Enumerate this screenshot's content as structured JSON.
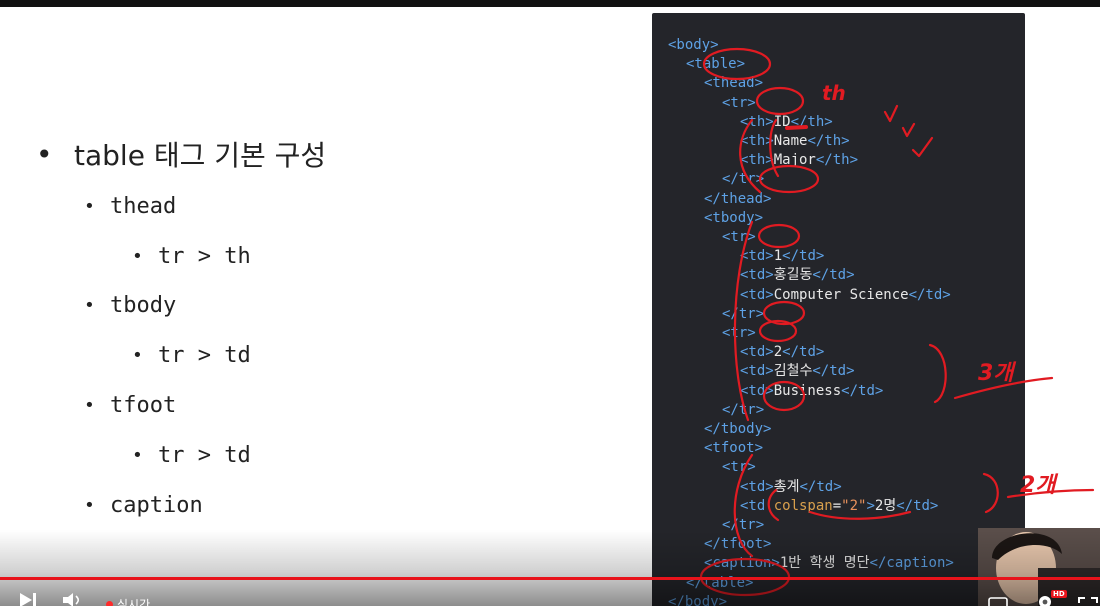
{
  "slide": {
    "bullets": [
      {
        "level": 1,
        "text": "table 태그 기본 구성"
      },
      {
        "level": 2,
        "text": "thead"
      },
      {
        "level": 3,
        "text": "tr > th"
      },
      {
        "level": 2,
        "text": "tbody"
      },
      {
        "level": 3,
        "text": "tr > td"
      },
      {
        "level": 2,
        "text": "tfoot"
      },
      {
        "level": 3,
        "text": "tr > td"
      },
      {
        "level": 2,
        "text": "caption"
      }
    ],
    "bullet_glyphs": {
      "level1": "•",
      "level2": "•",
      "level3": "•"
    }
  },
  "code": {
    "lines": [
      {
        "indent": 0,
        "parts": [
          {
            "t": "tag",
            "v": "<body>"
          }
        ]
      },
      {
        "indent": 1,
        "parts": [
          {
            "t": "tag",
            "v": "<table>"
          }
        ]
      },
      {
        "indent": 2,
        "parts": [
          {
            "t": "tag",
            "v": "<thead>"
          }
        ]
      },
      {
        "indent": 3,
        "parts": [
          {
            "t": "tag",
            "v": "<tr>"
          }
        ]
      },
      {
        "indent": 4,
        "parts": [
          {
            "t": "tag",
            "v": "<th>"
          },
          {
            "t": "txt",
            "v": "ID"
          },
          {
            "t": "tag",
            "v": "</th>"
          }
        ]
      },
      {
        "indent": 4,
        "parts": [
          {
            "t": "tag",
            "v": "<th>"
          },
          {
            "t": "txt",
            "v": "Name"
          },
          {
            "t": "tag",
            "v": "</th>"
          }
        ]
      },
      {
        "indent": 4,
        "parts": [
          {
            "t": "tag",
            "v": "<th>"
          },
          {
            "t": "txt",
            "v": "Major"
          },
          {
            "t": "tag",
            "v": "</th>"
          }
        ]
      },
      {
        "indent": 3,
        "parts": [
          {
            "t": "tag",
            "v": "</tr>"
          }
        ]
      },
      {
        "indent": 2,
        "parts": [
          {
            "t": "tag",
            "v": "</thead>"
          }
        ]
      },
      {
        "indent": 2,
        "parts": [
          {
            "t": "tag",
            "v": "<tbody>"
          }
        ]
      },
      {
        "indent": 3,
        "parts": [
          {
            "t": "tag",
            "v": "<tr>"
          }
        ]
      },
      {
        "indent": 4,
        "parts": [
          {
            "t": "tag",
            "v": "<td>"
          },
          {
            "t": "txt",
            "v": "1"
          },
          {
            "t": "tag",
            "v": "</td>"
          }
        ]
      },
      {
        "indent": 4,
        "parts": [
          {
            "t": "tag",
            "v": "<td>"
          },
          {
            "t": "txt",
            "v": "홍길동"
          },
          {
            "t": "tag",
            "v": "</td>"
          }
        ]
      },
      {
        "indent": 4,
        "parts": [
          {
            "t": "tag",
            "v": "<td>"
          },
          {
            "t": "txt",
            "v": "Computer Science"
          },
          {
            "t": "tag",
            "v": "</td>"
          }
        ]
      },
      {
        "indent": 3,
        "parts": [
          {
            "t": "tag",
            "v": "</tr>"
          }
        ]
      },
      {
        "indent": 3,
        "parts": [
          {
            "t": "tag",
            "v": "<tr>"
          }
        ]
      },
      {
        "indent": 4,
        "parts": [
          {
            "t": "tag",
            "v": "<td>"
          },
          {
            "t": "txt",
            "v": "2"
          },
          {
            "t": "tag",
            "v": "</td>"
          }
        ]
      },
      {
        "indent": 4,
        "parts": [
          {
            "t": "tag",
            "v": "<td>"
          },
          {
            "t": "txt",
            "v": "김철수"
          },
          {
            "t": "tag",
            "v": "</td>"
          }
        ]
      },
      {
        "indent": 4,
        "parts": [
          {
            "t": "tag",
            "v": "<td>"
          },
          {
            "t": "txt",
            "v": "Business"
          },
          {
            "t": "tag",
            "v": "</td>"
          }
        ]
      },
      {
        "indent": 3,
        "parts": [
          {
            "t": "tag",
            "v": "</tr>"
          }
        ]
      },
      {
        "indent": 2,
        "parts": [
          {
            "t": "tag",
            "v": "</tbody>"
          }
        ]
      },
      {
        "indent": 2,
        "parts": [
          {
            "t": "tag",
            "v": "<tfoot>"
          }
        ]
      },
      {
        "indent": 3,
        "parts": [
          {
            "t": "tag",
            "v": "<tr>"
          }
        ]
      },
      {
        "indent": 4,
        "parts": [
          {
            "t": "tag",
            "v": "<td>"
          },
          {
            "t": "txt",
            "v": "총계"
          },
          {
            "t": "tag",
            "v": "</td>"
          }
        ]
      },
      {
        "indent": 4,
        "parts": [
          {
            "t": "tag",
            "v": "<td "
          },
          {
            "t": "attr",
            "v": "colspan"
          },
          {
            "t": "txt",
            "v": "="
          },
          {
            "t": "str",
            "v": "\"2\""
          },
          {
            "t": "tag",
            "v": ">"
          },
          {
            "t": "txt",
            "v": "2명"
          },
          {
            "t": "tag",
            "v": "</td>"
          }
        ]
      },
      {
        "indent": 3,
        "parts": [
          {
            "t": "tag",
            "v": "</tr>"
          }
        ]
      },
      {
        "indent": 2,
        "parts": [
          {
            "t": "tag",
            "v": "</tfoot>"
          }
        ]
      },
      {
        "indent": 2,
        "parts": [
          {
            "t": "tag",
            "v": "<caption>"
          },
          {
            "t": "txt",
            "v": "1반 학생 명단"
          },
          {
            "t": "tag",
            "v": "</caption>"
          }
        ]
      },
      {
        "indent": 1,
        "parts": [
          {
            "t": "tag",
            "v": "</table>"
          }
        ]
      },
      {
        "indent": 0,
        "parts": [
          {
            "t": "tag",
            "v": "</body>"
          }
        ]
      }
    ]
  },
  "annotations": {
    "th_note": "th",
    "count_3": "3개",
    "count_2": "2개",
    "ink_color": "#e11b22"
  },
  "player": {
    "live_label": "실시간",
    "hd_label": "HD",
    "progress_color": "#e8131b",
    "icons": [
      "next-icon",
      "volume-icon",
      "subtitles-icon",
      "settings-icon",
      "fullscreen-icon"
    ]
  }
}
